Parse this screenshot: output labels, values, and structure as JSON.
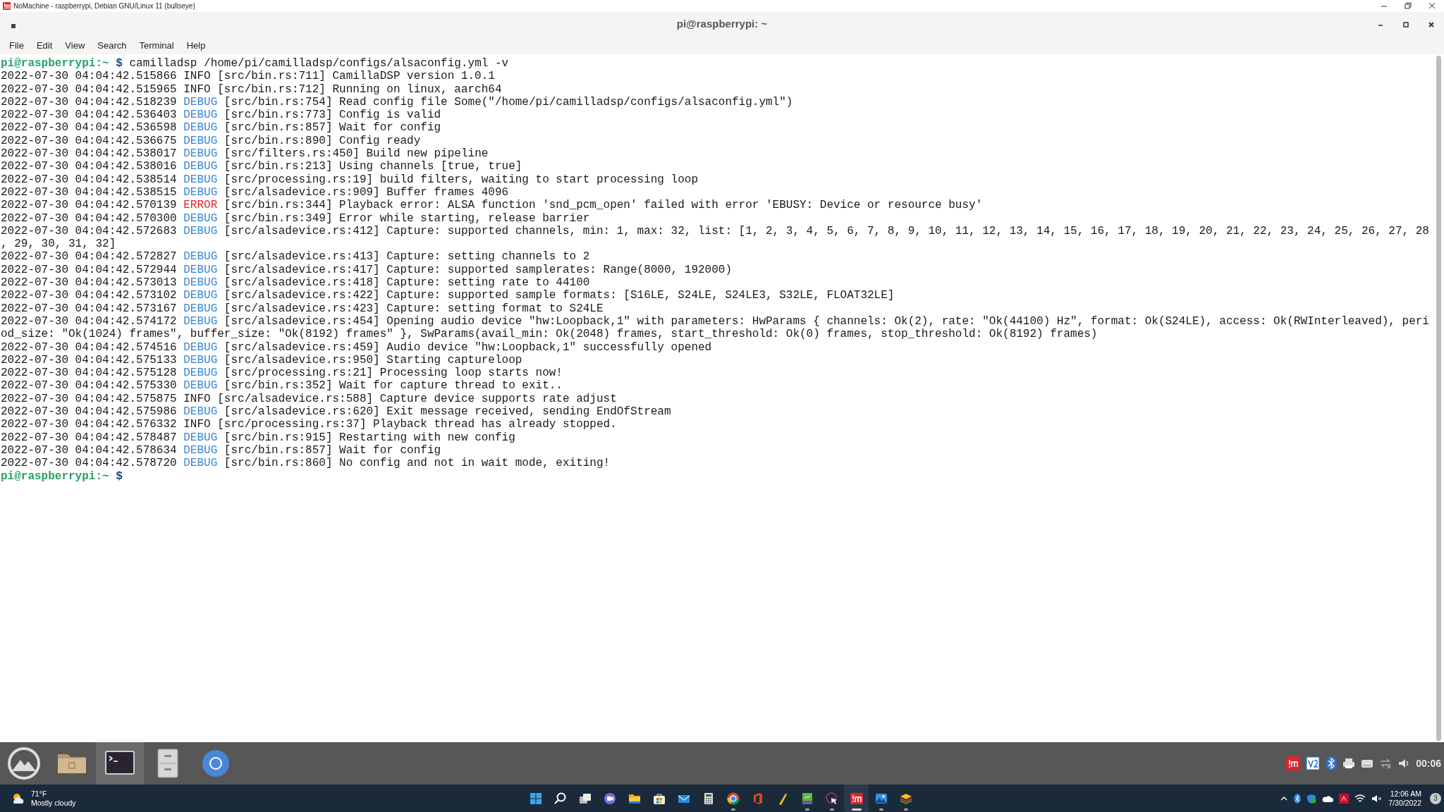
{
  "host_window": {
    "title": "NoMachine - raspberrypi, Debian GNU/Linux 11 (bullseye)"
  },
  "terminal_window": {
    "title": "pi@raspberrypi: ~"
  },
  "menu": [
    "File",
    "Edit",
    "View",
    "Search",
    "Terminal",
    "Help"
  ],
  "terminal_lines": [
    {
      "kind": "prompt",
      "prompt": "pi@raspberrypi:~",
      "symbol": "$",
      "command": "camilladsp /home/pi/camilladsp/configs/alsaconfig.yml -v"
    },
    {
      "kind": "log",
      "time": "2022-07-30 04:04:42.515866",
      "level": "INFO",
      "color": "#1a1a1a",
      "message": "[src/bin.rs:711] CamillaDSP version 1.0.1"
    },
    {
      "kind": "log",
      "time": "2022-07-30 04:04:42.515965",
      "level": "INFO",
      "color": "#1a1a1a",
      "message": "[src/bin.rs:712] Running on linux, aarch64"
    },
    {
      "kind": "log",
      "time": "2022-07-30 04:04:42.518239",
      "level": "DEBUG",
      "color": "#3a86d4",
      "message": "[src/bin.rs:754] Read config file Some(\"/home/pi/camilladsp/configs/alsaconfig.yml\")"
    },
    {
      "kind": "log",
      "time": "2022-07-30 04:04:42.536403",
      "level": "DEBUG",
      "color": "#3a86d4",
      "message": "[src/bin.rs:773] Config is valid"
    },
    {
      "kind": "log",
      "time": "2022-07-30 04:04:42.536598",
      "level": "DEBUG",
      "color": "#3a86d4",
      "message": "[src/bin.rs:857] Wait for config"
    },
    {
      "kind": "log",
      "time": "2022-07-30 04:04:42.536675",
      "level": "DEBUG",
      "color": "#3a86d4",
      "message": "[src/bin.rs:890] Config ready"
    },
    {
      "kind": "log",
      "time": "2022-07-30 04:04:42.538017",
      "level": "DEBUG",
      "color": "#3a86d4",
      "message": "[src/filters.rs:450] Build new pipeline"
    },
    {
      "kind": "log",
      "time": "2022-07-30 04:04:42.538016",
      "level": "DEBUG",
      "color": "#3a86d4",
      "message": "[src/bin.rs:213] Using channels [true, true]"
    },
    {
      "kind": "log",
      "time": "2022-07-30 04:04:42.538514",
      "level": "DEBUG",
      "color": "#3a86d4",
      "message": "[src/processing.rs:19] build filters, waiting to start processing loop"
    },
    {
      "kind": "log",
      "time": "2022-07-30 04:04:42.538515",
      "level": "DEBUG",
      "color": "#3a86d4",
      "message": "[src/alsadevice.rs:909] Buffer frames 4096"
    },
    {
      "kind": "log",
      "time": "2022-07-30 04:04:42.570139",
      "level": "ERROR",
      "color": "#e5262c",
      "message": "[src/bin.rs:344] Playback error: ALSA function 'snd_pcm_open' failed with error 'EBUSY: Device or resource busy'"
    },
    {
      "kind": "log",
      "time": "2022-07-30 04:04:42.570300",
      "level": "DEBUG",
      "color": "#3a86d4",
      "message": "[src/bin.rs:349] Error while starting, release barrier"
    },
    {
      "kind": "log",
      "time": "2022-07-30 04:04:42.572683",
      "level": "DEBUG",
      "color": "#3a86d4",
      "message": "[src/alsadevice.rs:412] Capture: supported channels, min: 1, max: 32, list: [1, 2, 3, 4, 5, 6, 7, 8, 9, 10, 11, 12, 13, 14, 15, 16, 17, 18, 19, 20, 21, 22, 23, 24, 25, 26, 27, 28"
    },
    {
      "kind": "continuation",
      "text": ", 29, 30, 31, 32]"
    },
    {
      "kind": "log",
      "time": "2022-07-30 04:04:42.572827",
      "level": "DEBUG",
      "color": "#3a86d4",
      "message": "[src/alsadevice.rs:413] Capture: setting channels to 2"
    },
    {
      "kind": "log",
      "time": "2022-07-30 04:04:42.572944",
      "level": "DEBUG",
      "color": "#3a86d4",
      "message": "[src/alsadevice.rs:417] Capture: supported samplerates: Range(8000, 192000)"
    },
    {
      "kind": "log",
      "time": "2022-07-30 04:04:42.573013",
      "level": "DEBUG",
      "color": "#3a86d4",
      "message": "[src/alsadevice.rs:418] Capture: setting rate to 44100"
    },
    {
      "kind": "log",
      "time": "2022-07-30 04:04:42.573102",
      "level": "DEBUG",
      "color": "#3a86d4",
      "message": "[src/alsadevice.rs:422] Capture: supported sample formats: [S16LE, S24LE, S24LE3, S32LE, FLOAT32LE]"
    },
    {
      "kind": "log",
      "time": "2022-07-30 04:04:42.573167",
      "level": "DEBUG",
      "color": "#3a86d4",
      "message": "[src/alsadevice.rs:423] Capture: setting format to S24LE"
    },
    {
      "kind": "log",
      "time": "2022-07-30 04:04:42.574172",
      "level": "DEBUG",
      "color": "#3a86d4",
      "message": "[src/alsadevice.rs:454] Opening audio device \"hw:Loopback,1\" with parameters: HwParams { channels: Ok(2), rate: \"Ok(44100) Hz\", format: Ok(S24LE), access: Ok(RWInterleaved), peri"
    },
    {
      "kind": "continuation",
      "text": "od_size: \"Ok(1024) frames\", buffer_size: \"Ok(8192) frames\" }, SwParams(avail_min: Ok(2048) frames, start_threshold: Ok(0) frames, stop_threshold: Ok(8192) frames)"
    },
    {
      "kind": "log",
      "time": "2022-07-30 04:04:42.574516",
      "level": "DEBUG",
      "color": "#3a86d4",
      "message": "[src/alsadevice.rs:459] Audio device \"hw:Loopback,1\" successfully opened"
    },
    {
      "kind": "log",
      "time": "2022-07-30 04:04:42.575133",
      "level": "DEBUG",
      "color": "#3a86d4",
      "message": "[src/alsadevice.rs:950] Starting captureloop"
    },
    {
      "kind": "log",
      "time": "2022-07-30 04:04:42.575128",
      "level": "DEBUG",
      "color": "#3a86d4",
      "message": "[src/processing.rs:21] Processing loop starts now!"
    },
    {
      "kind": "log",
      "time": "2022-07-30 04:04:42.575330",
      "level": "DEBUG",
      "color": "#3a86d4",
      "message": "[src/bin.rs:352] Wait for capture thread to exit.."
    },
    {
      "kind": "log",
      "time": "2022-07-30 04:04:42.575875",
      "level": "INFO",
      "color": "#1a1a1a",
      "message": "[src/alsadevice.rs:588] Capture device supports rate adjust"
    },
    {
      "kind": "log",
      "time": "2022-07-30 04:04:42.575986",
      "level": "DEBUG",
      "color": "#3a86d4",
      "message": "[src/alsadevice.rs:620] Exit message received, sending EndOfStream"
    },
    {
      "kind": "log",
      "time": "2022-07-30 04:04:42.576332",
      "level": "INFO",
      "color": "#1a1a1a",
      "message": "[src/processing.rs:37] Playback thread has already stopped."
    },
    {
      "kind": "log",
      "time": "2022-07-30 04:04:42.578487",
      "level": "DEBUG",
      "color": "#3a86d4",
      "message": "[src/bin.rs:915] Restarting with new config"
    },
    {
      "kind": "log",
      "time": "2022-07-30 04:04:42.578634",
      "level": "DEBUG",
      "color": "#3a86d4",
      "message": "[src/bin.rs:857] Wait for config"
    },
    {
      "kind": "log",
      "time": "2022-07-30 04:04:42.578720",
      "level": "DEBUG",
      "color": "#3a86d4",
      "message": "[src/bin.rs:860] No config and not in wait mode, exiting!"
    },
    {
      "kind": "prompt",
      "prompt": "pi@raspberrypi:~",
      "symbol": "$"
    }
  ],
  "pi_panel": {
    "launchers": [
      {
        "selected": false
      },
      {
        "selected": false
      },
      {
        "selected": true
      },
      {
        "selected": false
      },
      {
        "selected": false
      }
    ],
    "clock": "00:06"
  },
  "taskbar": {
    "weather": {
      "temperature": "71°F",
      "condition": "Mostly cloudy"
    },
    "apps": [
      {
        "running": false,
        "selected": false
      },
      {
        "running": false,
        "selected": false
      },
      {
        "running": false,
        "selected": false
      },
      {
        "running": false,
        "selected": false
      },
      {
        "running": false,
        "selected": false
      },
      {
        "running": false,
        "selected": false
      },
      {
        "running": false,
        "selected": false
      },
      {
        "running": false,
        "selected": false
      },
      {
        "running": true,
        "selected": false
      },
      {
        "running": false,
        "selected": false
      },
      {
        "running": false,
        "selected": false
      },
      {
        "running": true,
        "selected": false
      },
      {
        "running": true,
        "selected": false
      },
      {
        "running": true,
        "selected": true
      },
      {
        "running": true,
        "selected": false
      },
      {
        "running": true,
        "selected": false
      }
    ],
    "time": "12:06 AM",
    "date": "7/30/2022",
    "notifications": "3"
  }
}
